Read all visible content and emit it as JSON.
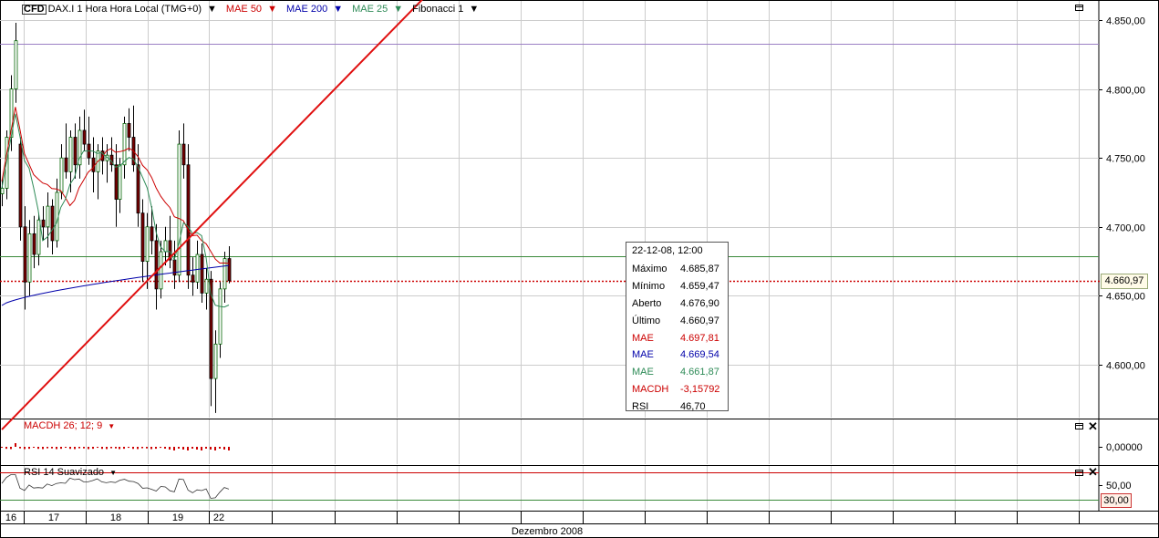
{
  "header": {
    "instrument_badge": "CFD",
    "instrument": "DAX.I 1 Hora Hora Local (TMG+0)",
    "indicators": [
      {
        "label": "MAE 50",
        "color": "#cc0000"
      },
      {
        "label": "MAE 200",
        "color": "#0000aa"
      },
      {
        "label": "MAE 25",
        "color": "#2e8b57"
      },
      {
        "label": "Fibonacci 1",
        "color": "#000000"
      }
    ],
    "dropdown_glyph": "▼"
  },
  "macd_panel": {
    "label": "MACDH 26; 12; 9",
    "zero_label": "0,00000"
  },
  "rsi_panel": {
    "label": "RSI 14 Suavizado",
    "tick_50": "50,00",
    "tag_30": "30,00"
  },
  "price_tag": "4.660,97",
  "tooltip": {
    "date": "22-12-08, 12:00",
    "rows": [
      {
        "label": "Máximo",
        "value": "4.685,87",
        "color": "#000000"
      },
      {
        "label": "Mínimo",
        "value": "4.659,47",
        "color": "#000000"
      },
      {
        "label": "Aberto",
        "value": "4.676,90",
        "color": "#000000"
      },
      {
        "label": "Último",
        "value": "4.660,97",
        "color": "#000000"
      },
      {
        "label": "MAE",
        "value": "4.697,81",
        "color": "#cc0000"
      },
      {
        "label": "MAE",
        "value": "4.669,54",
        "color": "#0000aa"
      },
      {
        "label": "MAE",
        "value": "4.661,87",
        "color": "#2e8b57"
      },
      {
        "label": "MACDH",
        "value": "-3,15792",
        "color": "#cc0000"
      },
      {
        "label": "RSI",
        "value": "46,70",
        "color": "#000000"
      }
    ]
  },
  "x_axis": {
    "day_labels": [
      "16",
      "17",
      "18",
      "19",
      "22"
    ],
    "month_label": "Dezembro 2008"
  },
  "chart_data": {
    "type": "candlestick",
    "title": "DAX.I 1 Hora Hora Local (TMG+0)",
    "y_ticks": [
      "4.850,00",
      "4.800,00",
      "4.750,00",
      "4.700,00",
      "4.650,00",
      "4.600,00"
    ],
    "y_tick_values": [
      4850,
      4800,
      4750,
      4700,
      4650,
      4600
    ],
    "ylim": [
      4557,
      4866
    ],
    "x_categories": [
      "16",
      "17",
      "18",
      "19",
      "22"
    ],
    "horizontal_lines": [
      {
        "value": 4833,
        "color": "#9b7fc4"
      },
      {
        "value": 4679,
        "color": "#3a8a3a"
      },
      {
        "value": 4661,
        "color": "#cc0000",
        "style": "dotted"
      }
    ],
    "trendline": {
      "from": [
        0,
        4553
      ],
      "to": [
        95,
        4873
      ],
      "color": "#e01010"
    },
    "candles": [
      [
        4724,
        4735,
        4715,
        4728
      ],
      [
        4728,
        4770,
        4720,
        4765
      ],
      [
        4765,
        4810,
        4755,
        4800
      ],
      [
        4800,
        4848,
        4790,
        4835
      ],
      [
        4760,
        4765,
        4690,
        4700
      ],
      [
        4700,
        4715,
        4640,
        4660
      ],
      [
        4660,
        4705,
        4650,
        4695
      ],
      [
        4695,
        4708,
        4670,
        4680
      ],
      [
        4680,
        4710,
        4672,
        4705
      ],
      [
        4705,
        4715,
        4690,
        4700
      ],
      [
        4700,
        4725,
        4685,
        4715
      ],
      [
        4715,
        4720,
        4680,
        4690
      ],
      [
        4690,
        4735,
        4685,
        4725
      ],
      [
        4725,
        4760,
        4720,
        4750
      ],
      [
        4750,
        4775,
        4735,
        4740
      ],
      [
        4740,
        4770,
        4725,
        4765
      ],
      [
        4765,
        4775,
        4735,
        4745
      ],
      [
        4745,
        4780,
        4735,
        4770
      ],
      [
        4770,
        4785,
        4755,
        4760
      ],
      [
        4760,
        4780,
        4745,
        4750
      ],
      [
        4750,
        4765,
        4725,
        4740
      ],
      [
        4740,
        4760,
        4720,
        4755
      ],
      [
        4755,
        4765,
        4738,
        4748
      ],
      [
        4748,
        4760,
        4732,
        4752
      ],
      [
        4752,
        4765,
        4740,
        4745
      ],
      [
        4745,
        4760,
        4700,
        4720
      ],
      [
        4720,
        4750,
        4710,
        4745
      ],
      [
        4745,
        4780,
        4735,
        4775
      ],
      [
        4775,
        4786,
        4755,
        4765
      ],
      [
        4765,
        4788,
        4740,
        4745
      ],
      [
        4745,
        4760,
        4700,
        4710
      ],
      [
        4710,
        4720,
        4660,
        4675
      ],
      [
        4675,
        4710,
        4655,
        4700
      ],
      [
        4700,
        4715,
        4680,
        4690
      ],
      [
        4690,
        4702,
        4640,
        4655
      ],
      [
        4655,
        4690,
        4648,
        4682
      ],
      [
        4682,
        4700,
        4672,
        4690
      ],
      [
        4690,
        4708,
        4670,
        4676
      ],
      [
        4676,
        4690,
        4655,
        4665
      ],
      [
        4665,
        4770,
        4660,
        4760
      ],
      [
        4760,
        4775,
        4735,
        4745
      ],
      [
        4745,
        4760,
        4655,
        4665
      ],
      [
        4665,
        4678,
        4650,
        4660
      ],
      [
        4660,
        4690,
        4655,
        4680
      ],
      [
        4680,
        4688,
        4645,
        4652
      ],
      [
        4652,
        4670,
        4640,
        4662
      ],
      [
        4662,
        4668,
        4570,
        4590
      ],
      [
        4590,
        4625,
        4565,
        4615
      ],
      [
        4615,
        4660,
        4605,
        4655
      ],
      [
        4655,
        4682,
        4645,
        4677
      ],
      [
        4677,
        4686,
        4659,
        4661
      ]
    ],
    "ma_series": [
      {
        "name": "MAE 50",
        "color": "#cc0000"
      },
      {
        "name": "MAE 200",
        "color": "#0000aa"
      },
      {
        "name": "MAE 25",
        "color": "#2e8b57"
      }
    ]
  }
}
